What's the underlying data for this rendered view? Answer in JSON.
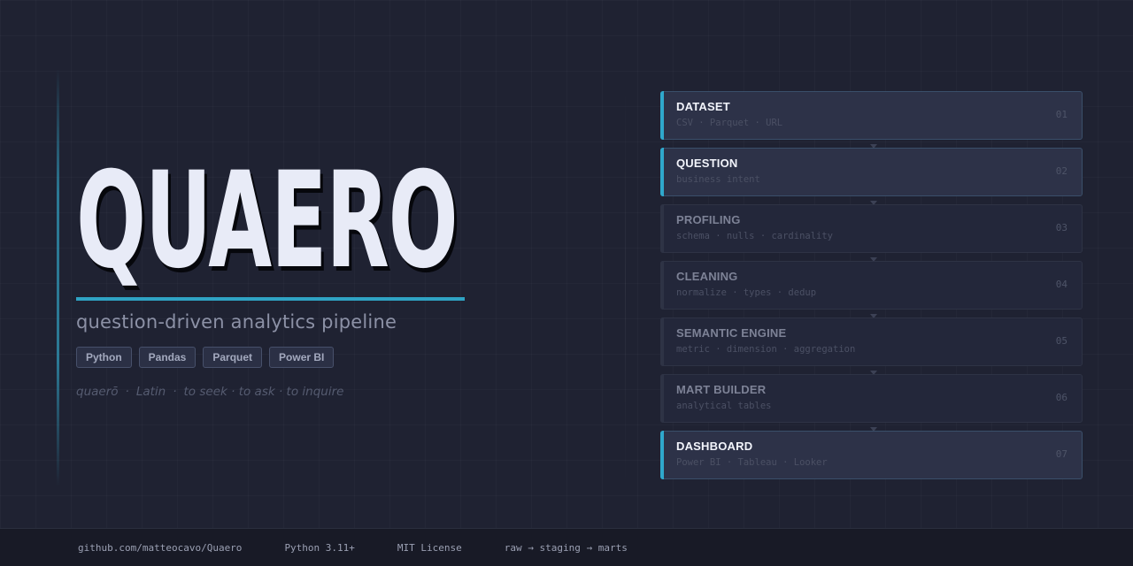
{
  "hero": {
    "title": "QUAERO",
    "subtitle": "question-driven analytics pipeline",
    "tags": [
      "Python",
      "Pandas",
      "Parquet",
      "Power BI"
    ],
    "etymology": {
      "word": "quaerō",
      "language": "Latin",
      "meaning": "to seek · to ask · to inquire"
    }
  },
  "pipeline": {
    "steps": [
      {
        "name": "DATASET",
        "desc": "CSV · Parquet · URL",
        "num": "01",
        "active": true
      },
      {
        "name": "QUESTION",
        "desc": "business intent",
        "num": "02",
        "active": true
      },
      {
        "name": "PROFILING",
        "desc": "schema · nulls · cardinality",
        "num": "03",
        "active": false
      },
      {
        "name": "CLEANING",
        "desc": "normalize · types · dedup",
        "num": "04",
        "active": false
      },
      {
        "name": "SEMANTIC ENGINE",
        "desc": "metric · dimension · aggregation",
        "num": "05",
        "active": false
      },
      {
        "name": "MART BUILDER",
        "desc": "analytical tables",
        "num": "06",
        "active": false
      },
      {
        "name": "DASHBOARD",
        "desc": "Power BI · Tableau · Looker",
        "num": "07",
        "active": true
      }
    ]
  },
  "footer": {
    "repo": "github.com/matteocavo/Quaero",
    "python": "Python 3.11+",
    "license": "MIT License",
    "flow": "raw → staging → marts"
  },
  "colors": {
    "accent": "#2fa8cc",
    "background": "#1f2232",
    "title": "#e8ebf7"
  }
}
